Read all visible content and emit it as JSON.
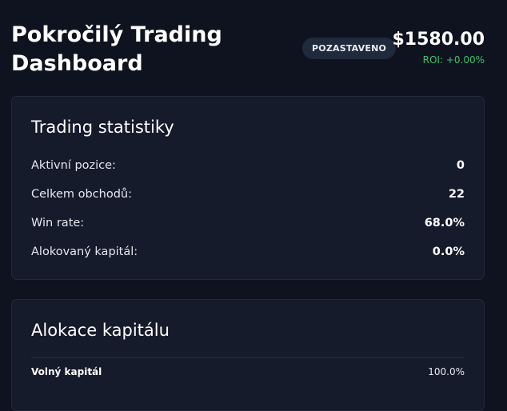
{
  "header": {
    "title": "Pokročilý Trading Dashboard",
    "status": "POZASTAVENO",
    "balance": "$1580.00",
    "roi": "ROI: +0.00%"
  },
  "colors": {
    "background": "#0f131f",
    "card": "#151b2a",
    "positive": "#39c56a"
  },
  "stats": {
    "title": "Trading statistiky",
    "rows": [
      {
        "label": "Aktivní pozice:",
        "value": "0"
      },
      {
        "label": "Celkem obchodů:",
        "value": "22"
      },
      {
        "label": "Win rate:",
        "value": "68.0%"
      },
      {
        "label": "Alokovaný kapitál:",
        "value": "0.0%"
      }
    ]
  },
  "allocation": {
    "title": "Alokace kapitálu",
    "free_label": "Volný kapitál",
    "free_value": "100.0%"
  }
}
